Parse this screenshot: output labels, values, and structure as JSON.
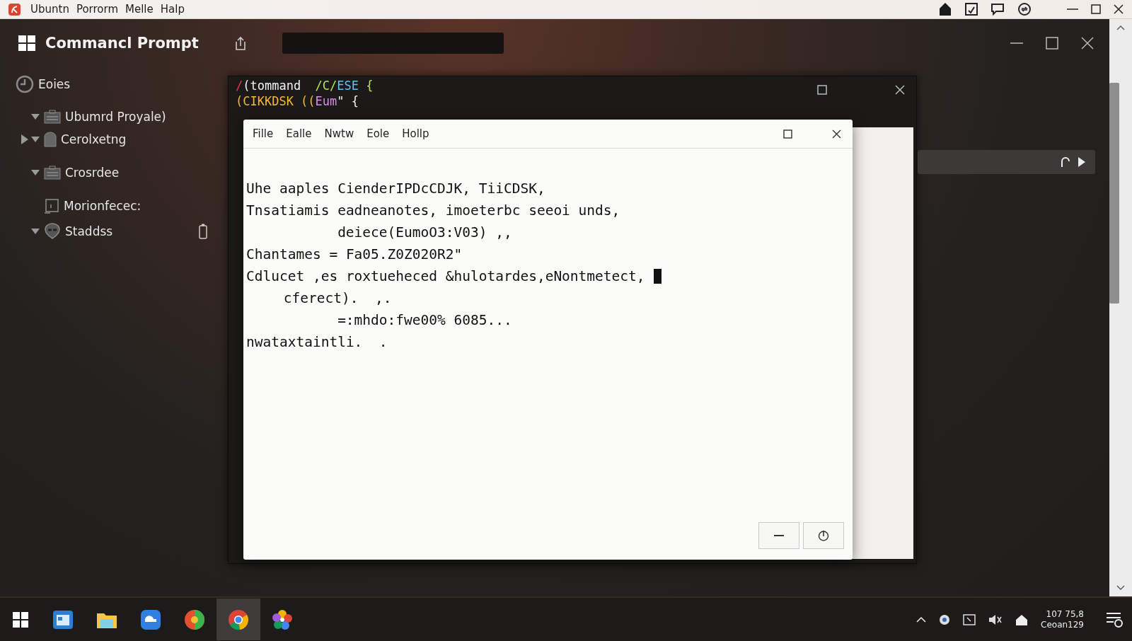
{
  "top_bar": {
    "menu": [
      "Ubuntn",
      "Porrorm",
      "Melle",
      "Halp"
    ]
  },
  "app": {
    "title": "Commancl Prompt"
  },
  "sidebar": {
    "items": [
      {
        "label": "Eoies",
        "kind": "root"
      },
      {
        "label": "Ubumrd Proyale)",
        "kind": "folder",
        "expanded": true
      },
      {
        "label": "Cerolxetng",
        "kind": "nested",
        "expanded": true
      },
      {
        "label": "Crosrdee",
        "kind": "folder",
        "expanded": true
      },
      {
        "label": "Morionfecec:",
        "kind": "leaf"
      },
      {
        "label": "Staddss",
        "kind": "status",
        "expanded": true
      }
    ]
  },
  "terminal": {
    "lines": [
      [
        {
          "text": "/",
          "color": "#e8334a"
        },
        {
          "text": "(tommand  ",
          "color": "#f2f2f2"
        },
        {
          "text": "/C/",
          "color": "#b5e35a"
        },
        {
          "text": "ESE",
          "color": "#5fc3f0"
        },
        {
          "text": " {",
          "color": "#b5e35a"
        }
      ],
      [
        {
          "text": "(CIKKDSK ((",
          "color": "#f5b731"
        },
        {
          "text": "Eum",
          "color": "#d98cf0"
        },
        {
          "text": "\" {",
          "color": "#f2f2f2"
        }
      ]
    ]
  },
  "dialog": {
    "menu": [
      "Fille",
      "Ealle",
      "Nwtw",
      "Eole",
      "Hollp"
    ],
    "lines": [
      {
        "text": "Uhe aaples CienderIPDcCDJK, TiiCDSK,",
        "kind": "line"
      },
      {
        "text": "Tnsatiamis eadneanotes, imoeterbc seeoi unds,",
        "kind": "line"
      },
      {
        "text": "deiece(EumoO3:V03) ,,",
        "kind": "deep"
      },
      {
        "text": "Chantames = Fa05.Z0Z020R2\"",
        "kind": "line"
      },
      {
        "text": "Cdlucet ,es roxtueheced &hulotardes,eNontmetect,",
        "kind": "line",
        "cursor": true
      },
      {
        "text": "cferect).  ,.",
        "kind": "indent"
      },
      {
        "text": "=:mhdo:fwe00% 6085...",
        "kind": "deep"
      },
      {
        "text": "nwataxtaintli.  .",
        "kind": "line"
      }
    ]
  },
  "taskbar": {
    "clock": {
      "time": "107 75,8",
      "date": "Ceoan129"
    }
  }
}
